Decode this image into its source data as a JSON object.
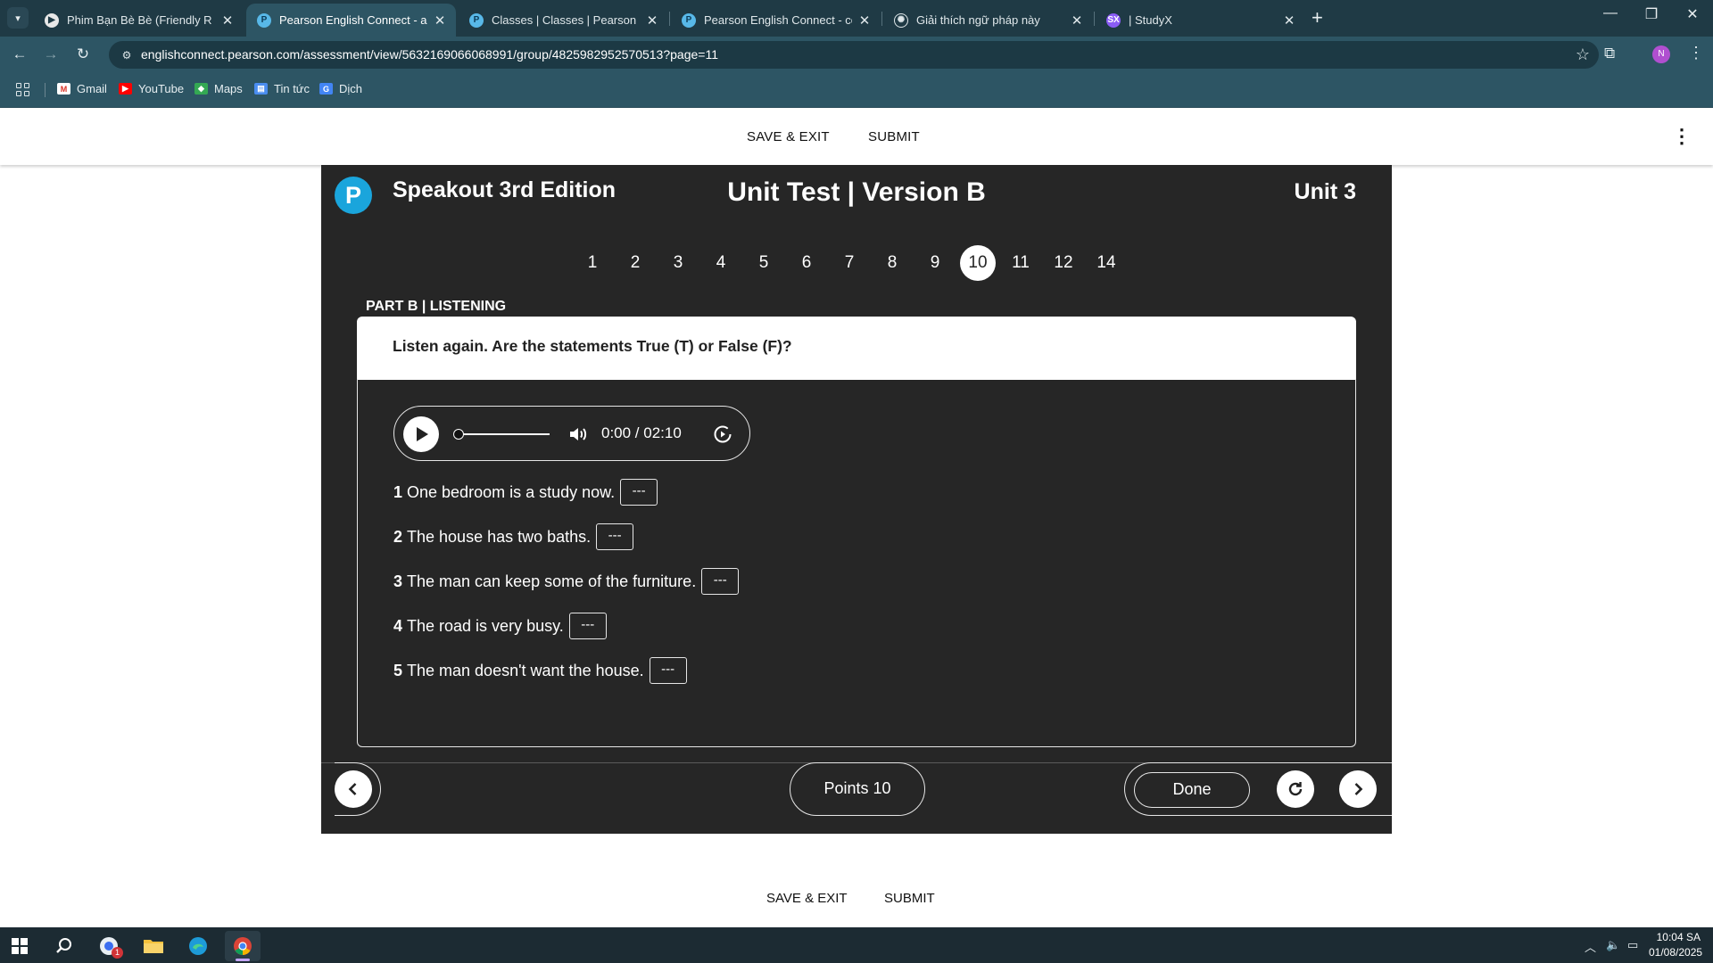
{
  "browser": {
    "tabs": [
      {
        "title": "Phim Bạn Bè Bè (Friendly R",
        "favicon": "play-icon",
        "active": false
      },
      {
        "title": "Pearson English Connect - asse",
        "favicon": "pearson-icon",
        "active": true
      },
      {
        "title": "Classes | Classes | Pearson Engl",
        "favicon": "pearson-icon",
        "active": false
      },
      {
        "title": "Pearson English Connect - cour",
        "favicon": "pearson-icon",
        "active": false
      },
      {
        "title": "Giải thích ngữ pháp này",
        "favicon": "chatgpt-icon",
        "active": false
      },
      {
        "title": "| StudyX",
        "favicon": "studyx-icon",
        "active": false
      }
    ],
    "url": "englishconnect.pearson.com/assessment/view/5632169066068991/group/4825982952570513?page=11",
    "profile_initial": "N",
    "bookmarks": [
      {
        "label": "Gmail",
        "icon": "gmail-icon"
      },
      {
        "label": "YouTube",
        "icon": "youtube-icon"
      },
      {
        "label": "Maps",
        "icon": "maps-icon"
      },
      {
        "label": "Tin tức",
        "icon": "news-icon"
      },
      {
        "label": "Dịch",
        "icon": "translate-icon"
      }
    ]
  },
  "header": {
    "save_exit": "SAVE & EXIT",
    "submit": "SUBMIT"
  },
  "activity": {
    "logo_letter": "P",
    "course": "Speakout 3rd Edition",
    "test": "Unit Test | Version B",
    "unit": "Unit 3",
    "pages": [
      "1",
      "2",
      "3",
      "4",
      "5",
      "6",
      "7",
      "8",
      "9",
      "10",
      "11",
      "12",
      "14"
    ],
    "current_page": "10",
    "part": "PART B | LISTENING",
    "instruction": "Listen again. Are the statements True (T) or False (F)?",
    "audio": {
      "time": "0:00 / 02:10",
      "progress": 0
    },
    "statements": [
      {
        "num": "1",
        "text": "One bedroom is a study now.",
        "answer": "---"
      },
      {
        "num": "2",
        "text": "The house has two baths.",
        "answer": "---"
      },
      {
        "num": "3",
        "text": "The man can keep some of the furniture.",
        "answer": "---"
      },
      {
        "num": "4",
        "text": "The road is very busy.",
        "answer": "---"
      },
      {
        "num": "5",
        "text": "The man doesn't want the house.",
        "answer": "---"
      }
    ],
    "points": "Points 10",
    "done": "Done"
  },
  "footer": {
    "save_exit": "SAVE & EXIT",
    "submit": "SUBMIT"
  },
  "taskbar": {
    "clock_time": "10:04 SA",
    "clock_date": "01/08/2025",
    "notification_badge": "1"
  },
  "colors": {
    "chrome_dark": "#1f3a45",
    "chrome_toolbar": "#2d5564",
    "activity_bg": "#262626",
    "pearson_blue": "#1aa5dc"
  }
}
